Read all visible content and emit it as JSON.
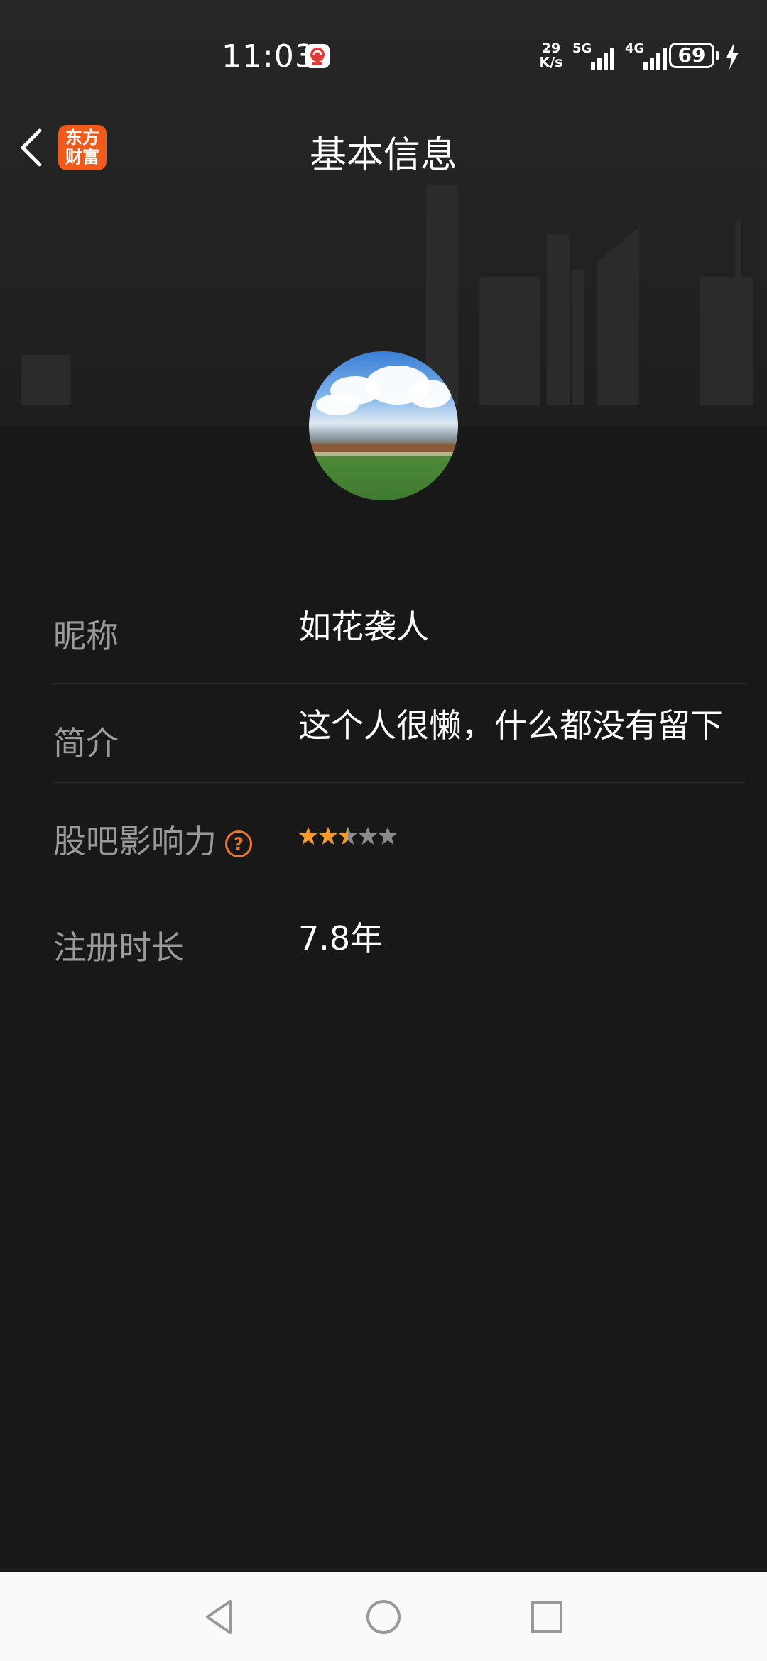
{
  "status_bar": {
    "time": "11:03",
    "net_speed_value": "29",
    "net_speed_unit": "K/s",
    "signal_1": "5G",
    "signal_2": "4G",
    "battery": "69"
  },
  "nav": {
    "back_icon": "chevron-left-icon",
    "logo_line1": "东方",
    "logo_line2": "财富",
    "title": "基本信息"
  },
  "profile": {
    "rows": [
      {
        "label": "昵称",
        "value": "如花袭人"
      },
      {
        "label": "简介",
        "value": "这个人很懒，什么都没有留下"
      },
      {
        "label": "股吧影响力",
        "help_icon": "question-circle-icon",
        "stars_rating": 2.5,
        "stars_max": 5
      },
      {
        "label": "注册时长",
        "value": "7.8年"
      }
    ]
  },
  "colors": {
    "background": "#181818",
    "accent_orange": "#f0782c",
    "star_filled": "#f39a2a",
    "star_empty": "#8a8a8a",
    "bottom_nav_bg": "#fafafa"
  },
  "system_nav": {
    "back": "triangle-back-icon",
    "home": "circle-home-icon",
    "recents": "square-recents-icon"
  }
}
